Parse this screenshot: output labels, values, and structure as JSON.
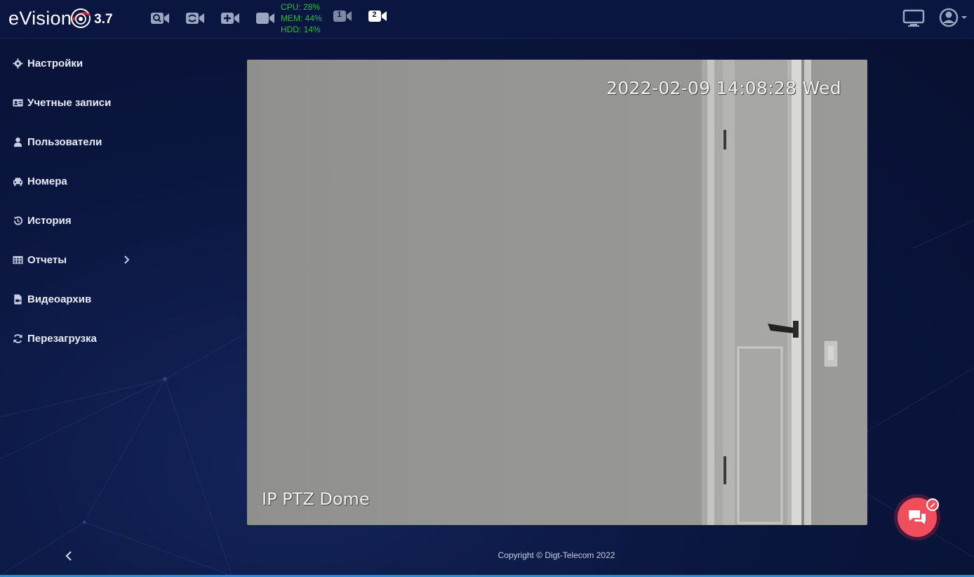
{
  "app": {
    "logo_text": "eVision",
    "version": "3.7"
  },
  "toolbar": {
    "camera_icons": [
      "camera-search-icon",
      "camera-switch-icon",
      "camera-add-icon",
      "camera-icon"
    ],
    "stats": {
      "cpu": "CPU: 28%",
      "mem": "MEM: 44%",
      "hdd": "HDD: 14%"
    },
    "stats_color": "#22c23a",
    "layouts": [
      {
        "label": "1",
        "active": false
      },
      {
        "label": "2",
        "active": true
      }
    ]
  },
  "sidebar": {
    "items": [
      {
        "label": "Настройки",
        "icon": "gear-icon"
      },
      {
        "label": "Учетные записи",
        "icon": "id-card-icon"
      },
      {
        "label": "Пользователи",
        "icon": "user-icon"
      },
      {
        "label": "Номера",
        "icon": "car-icon"
      },
      {
        "label": "История",
        "icon": "history-icon"
      },
      {
        "label": "Отчеты",
        "icon": "table-icon",
        "has_submenu": true
      },
      {
        "label": "Видеоархив",
        "icon": "video-file-icon"
      },
      {
        "label": "Перезагрузка",
        "icon": "refresh-icon"
      }
    ]
  },
  "video": {
    "timestamp": "2022-02-09 14:08:28 Wed",
    "camera_name": "IP PTZ Dome"
  },
  "footer": {
    "copyright": "Copyright © Digt-Telecom 2022"
  },
  "colors": {
    "background": "#0b1640",
    "accent": "#f04e5c",
    "bottom_line": "#1f8fd6"
  }
}
